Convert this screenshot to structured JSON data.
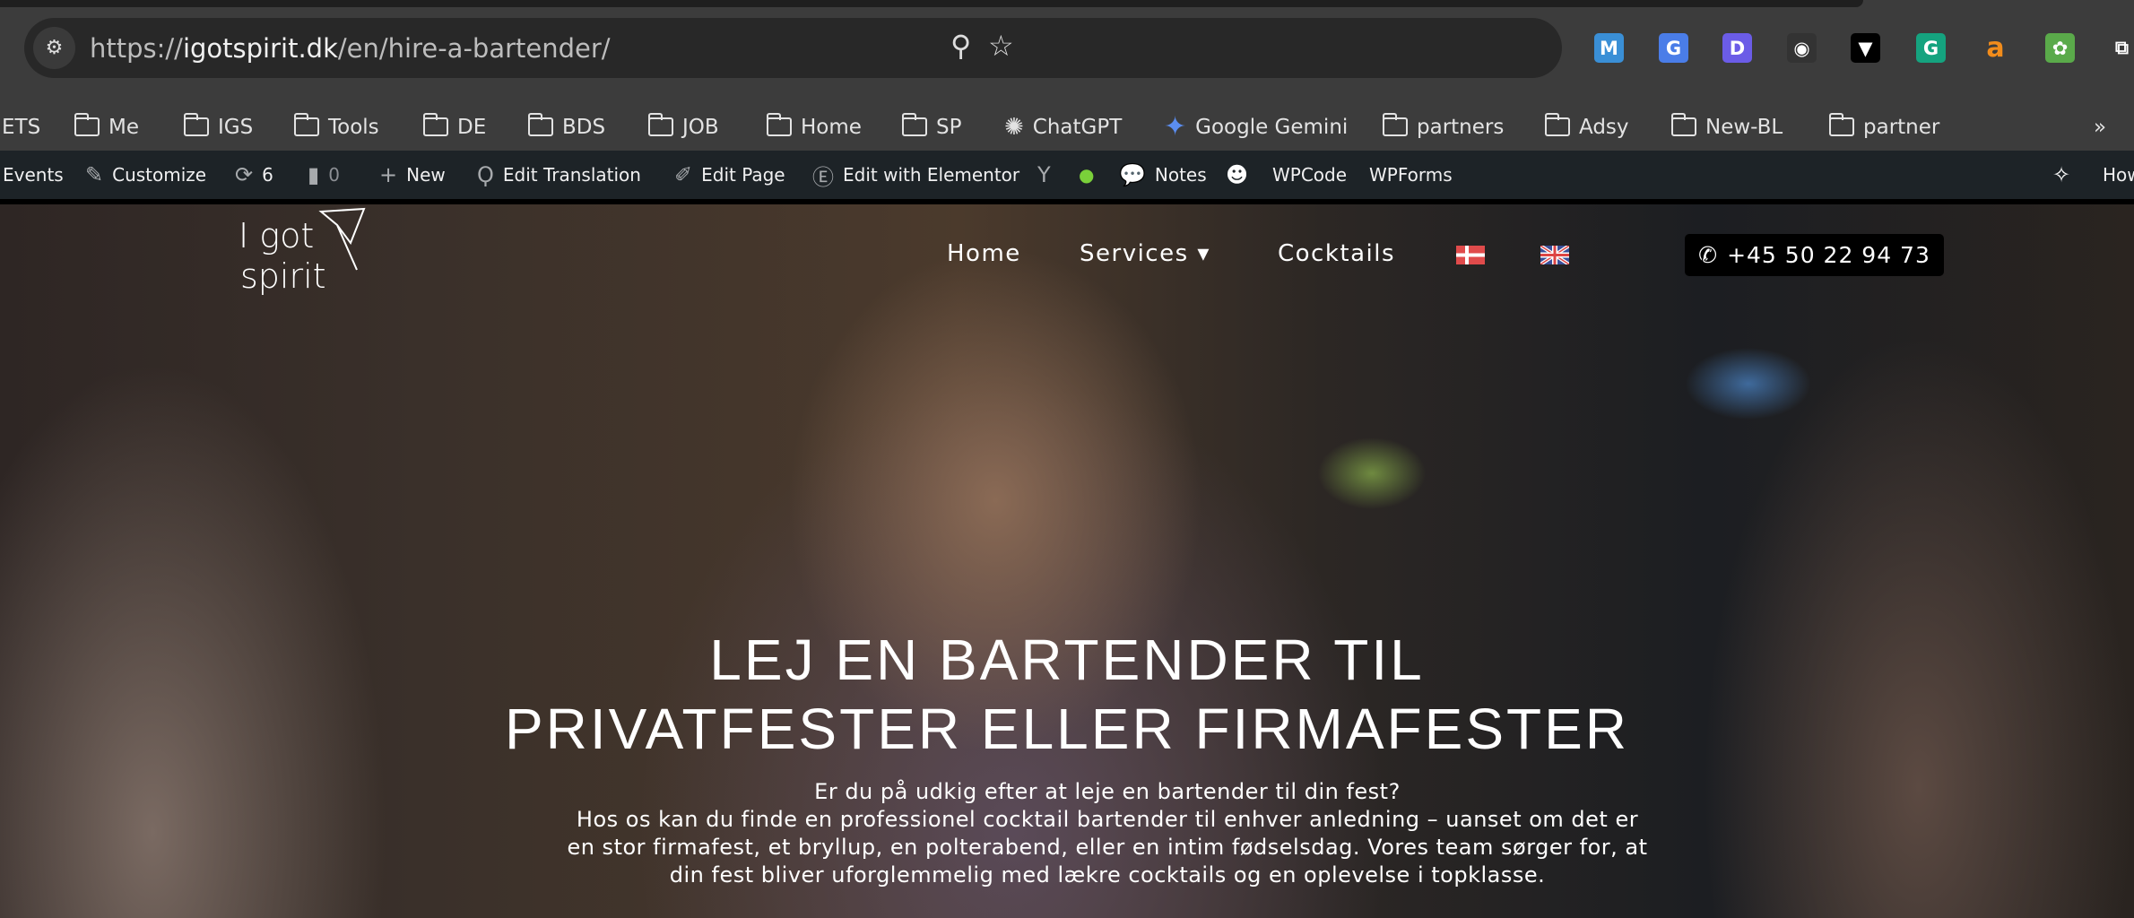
{
  "browser": {
    "url_prefix": "https://",
    "url_host": "igotspirit.dk",
    "url_path": "/en/hire-a-bartender/",
    "extensions": [
      {
        "name": "m-extension-icon",
        "glyph": "M",
        "color": "#3a8fd6"
      },
      {
        "name": "google-translate-icon",
        "glyph": "G",
        "color": "#4a7de8"
      },
      {
        "name": "d-extension-icon",
        "glyph": "D",
        "color": "#6b5ce7"
      },
      {
        "name": "color-picker-icon",
        "glyph": "◉",
        "color": "#333333"
      },
      {
        "name": "fox-extension-icon",
        "glyph": "▼",
        "color": "#000000"
      },
      {
        "name": "grammarly-icon",
        "glyph": "G",
        "color": "#15a37f"
      },
      {
        "name": "a-extension-icon",
        "glyph": "a",
        "color": "#3c3c3c"
      },
      {
        "name": "sprout-extension-icon",
        "glyph": "✿",
        "color": "#5aaa4a"
      },
      {
        "name": "puzzle-extension-icon",
        "glyph": "⧉",
        "color": "#3c3c3c"
      }
    ]
  },
  "bookmarks": [
    {
      "label": "ETS",
      "icon": "none"
    },
    {
      "label": "Me",
      "icon": "folder"
    },
    {
      "label": "IGS",
      "icon": "folder"
    },
    {
      "label": "Tools",
      "icon": "folder"
    },
    {
      "label": "DE",
      "icon": "folder"
    },
    {
      "label": "BDS",
      "icon": "folder"
    },
    {
      "label": "JOB",
      "icon": "folder"
    },
    {
      "label": "Home",
      "icon": "folder"
    },
    {
      "label": "SP",
      "icon": "folder"
    },
    {
      "label": "ChatGPT",
      "icon": "chatgpt"
    },
    {
      "label": "Google Gemini",
      "icon": "gemini"
    },
    {
      "label": "partners",
      "icon": "folder"
    },
    {
      "label": "Adsy",
      "icon": "folder"
    },
    {
      "label": "New-BL",
      "icon": "folder"
    },
    {
      "label": "partner",
      "icon": "folder"
    }
  ],
  "bookmarks_overflow": "»",
  "admin_bar": [
    {
      "label": "Events",
      "icon": ""
    },
    {
      "label": "Customize",
      "icon": "✎"
    },
    {
      "label": "6",
      "icon": "⟳"
    },
    {
      "label": "0",
      "icon": "▮"
    },
    {
      "label": "New",
      "icon": "+"
    },
    {
      "label": "Edit Translation",
      "icon": "Ϙ"
    },
    {
      "label": "Edit Page",
      "icon": "✐"
    },
    {
      "label": "Edit with Elementor",
      "icon": "Ⓔ"
    },
    {
      "label": "",
      "icon": "Y"
    },
    {
      "label": "",
      "icon": "●"
    },
    {
      "label": "Notes",
      "icon": "💬"
    },
    {
      "label": "",
      "icon": "☻"
    },
    {
      "label": "WPCode",
      "icon": ""
    },
    {
      "label": "WPForms",
      "icon": ""
    },
    {
      "label": "",
      "icon": "✧"
    },
    {
      "label": "How",
      "icon": ""
    }
  ],
  "site": {
    "logo_text": "I got spirit",
    "nav": {
      "home": "Home",
      "services": "Services",
      "services_caret": "▾",
      "cocktails": "Cocktails"
    },
    "phone": "+45 50 22 94 73",
    "heading_line1": "LEJ EN BARTENDER TIL",
    "heading_line2": "PRIVATFESTER ELLER FIRMAFESTER",
    "intro_line1": "Er du på udkig efter at leje en bartender til din fest?",
    "intro_rest": "Hos os kan du finde en professionel cocktail bartender til enhver anledning – uanset om det er en stor firmafest, et bryllup, en polterabend, eller en intim fødselsdag. Vores team sørger for, at din fest bliver uforglemmelig med lækre cocktails og en oplevelse i topklasse."
  }
}
